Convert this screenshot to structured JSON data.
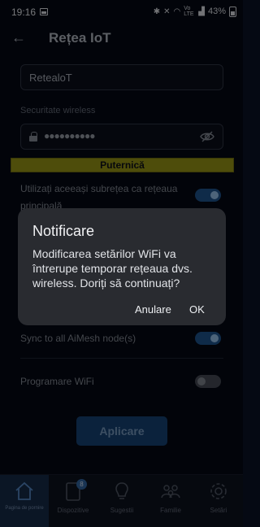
{
  "status_bar": {
    "time": "19:16",
    "network": "Vo LTE",
    "battery": "43%"
  },
  "header": {
    "title": "Rețea IoT"
  },
  "form": {
    "ssid_value": "RetealoT",
    "security_label": "Securitate wireless",
    "password_dots": "●●●●●●●●●●",
    "strength_label": "Puternică",
    "same_subnet_label": "Utilizați aceeași subrețea ca rețeaua principală",
    "same_subnet_on": true,
    "sync_label": "Sync to all AiMesh node(s)",
    "sync_on": true,
    "schedule_label": "Programare WiFi",
    "schedule_on": false,
    "apply_label": "Aplicare"
  },
  "bottom_nav": {
    "items": [
      {
        "label": "Pagina de pornire",
        "icon": "home-icon",
        "active": true
      },
      {
        "label": "Dispozitive",
        "icon": "devices-icon",
        "badge": "8"
      },
      {
        "label": "Sugestii",
        "icon": "lightbulb-icon"
      },
      {
        "label": "Familie",
        "icon": "family-icon"
      },
      {
        "label": "Setări",
        "icon": "gear-icon"
      }
    ]
  },
  "dialog": {
    "title": "Notificare",
    "message": "Modificarea setărilor WiFi va întrerupe temporar rețeaua dvs. wireless. Doriți să continuați?",
    "cancel_label": "Anulare",
    "ok_label": "OK"
  },
  "colors": {
    "accent": "#1c4f86",
    "strength": "#8e8c15",
    "dialog_bg": "#292b30"
  }
}
